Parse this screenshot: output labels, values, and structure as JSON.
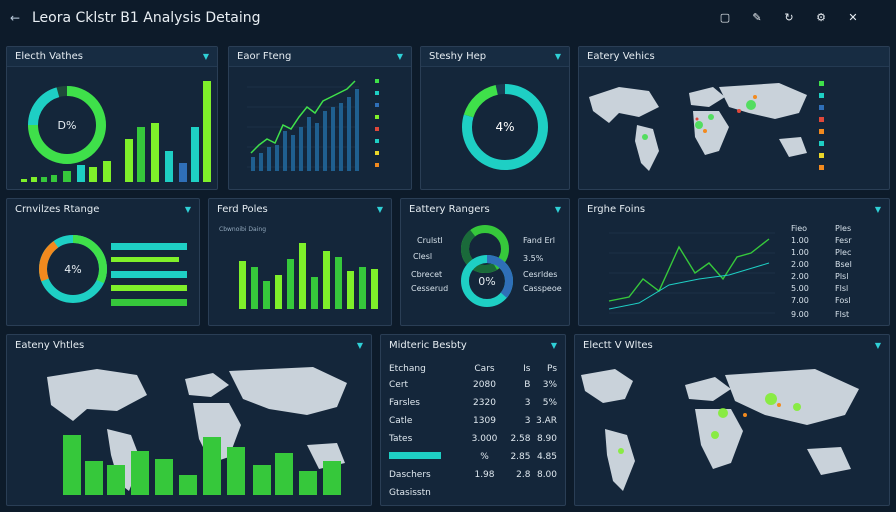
{
  "header": {
    "back_icon": "arrow-left-icon",
    "title": "Leora Cklstr B1 Analysis Detaing",
    "icons": [
      "square-icon",
      "pin-icon",
      "refresh-icon",
      "settings-icon",
      "close-icon"
    ]
  },
  "panels": {
    "p1": {
      "title": "Electh Vathes",
      "center": "D%"
    },
    "p2": {
      "title": "Eaor Fteng"
    },
    "p3": {
      "title": "Steshy Hep",
      "center": "4%"
    },
    "p4": {
      "title": "Eatery Vehics"
    },
    "p5": {
      "title": "Crnvilzes Rtange",
      "center": "4%"
    },
    "p6": {
      "title": "Ferd Poles",
      "subtitle": "Cbwnoibi Daing"
    },
    "p7": {
      "title": "Eattery Rangers",
      "center": "0%",
      "left_labels": [
        "Crulstl",
        "Clesl",
        "Cbrecet",
        "Cesserud"
      ],
      "right_labels": [
        "Fand Erl",
        "3.5%",
        "Cesrldes",
        "Casspeoe"
      ]
    },
    "p8": {
      "title": "Erghe Foins",
      "col1": [
        "Fieo",
        "1.00",
        "1.00",
        "2.00",
        "2.00",
        "5.00",
        "7.00",
        "9.00"
      ],
      "col2": [
        "Ples",
        "Fesr",
        "Plec",
        "Bsel",
        "Plsl",
        "Flsl",
        "Fosl",
        "Flst"
      ]
    },
    "p9": {
      "title": "Eateny Vhtles"
    },
    "p10": {
      "title": "Midteric Besbty",
      "rows": [
        [
          "Etchang",
          "Cars",
          "Is",
          "Ps"
        ],
        [
          "Cert",
          "2080",
          "B",
          "3%"
        ],
        [
          "Farsles",
          "2320",
          "3",
          "5%"
        ],
        [
          "Catle",
          "1309",
          "3",
          "3.AR"
        ],
        [
          "Tates",
          "3.000",
          "2.58",
          "8.90"
        ],
        [
          "",
          "%",
          "2.85",
          "4.85"
        ],
        [
          "Daschers",
          "1.98",
          "2.8",
          "8.00"
        ],
        [
          "Gtasisstn",
          "",
          "",
          ""
        ]
      ]
    },
    "p11": {
      "title": "Electt V Wltes"
    }
  },
  "colors": {
    "lime": "#7ff02a",
    "green": "#36c83b",
    "teal": "#1ecfc4",
    "blue": "#2f6fb8",
    "orange": "#f28a1e",
    "yellow": "#ead62a"
  }
}
